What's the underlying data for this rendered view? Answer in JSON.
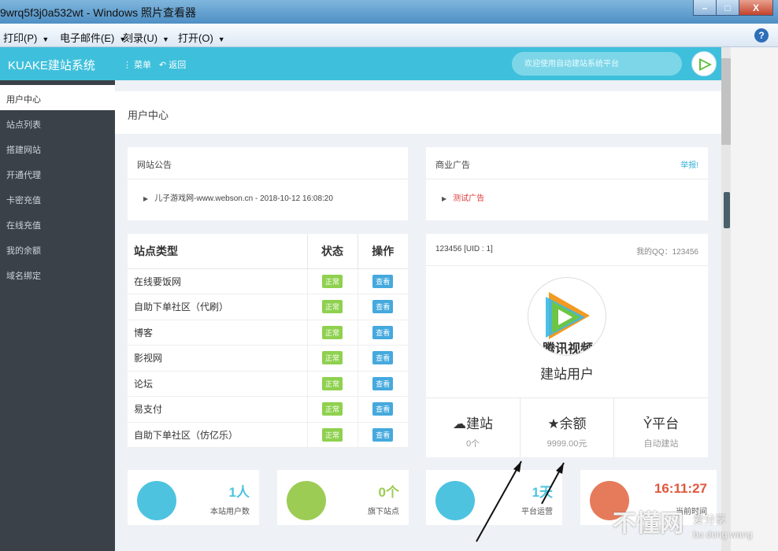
{
  "window": {
    "title": "9wrq5f3j0a532wt - Windows 照片查看器",
    "minimize_label": "–",
    "maximize_label": "□",
    "close_label": "X"
  },
  "menubar": {
    "items": [
      {
        "label": "打印(P)"
      },
      {
        "label": "电子邮件(E)"
      },
      {
        "label": "刻录(U)"
      },
      {
        "label": "打开(O)"
      }
    ],
    "help_label": "?"
  },
  "header": {
    "brand": "KUAKE建站系统",
    "menu_label": "菜单",
    "back_label": "返回",
    "search_placeholder": "欢迎使用自动建站系统平台"
  },
  "sidebar": {
    "items": [
      {
        "label": "用户中心",
        "active": true
      },
      {
        "label": "站点列表"
      },
      {
        "label": "搭建网站"
      },
      {
        "label": "开通代理"
      },
      {
        "label": "卡密充值"
      },
      {
        "label": "在线充值"
      },
      {
        "label": "我的余额"
      },
      {
        "label": "域名绑定"
      }
    ]
  },
  "page": {
    "title": "用户中心"
  },
  "announcement": {
    "title": "网站公告",
    "entry": "儿子游戏网-www.webson.cn - 2018-10-12 16:08:20"
  },
  "ads": {
    "title": "商业广告",
    "action": "举报!",
    "entry": "测试广告"
  },
  "sites_table": {
    "headers": [
      "站点类型",
      "状态",
      "操作"
    ],
    "status_label": "正常",
    "action_label": "查看",
    "rows": [
      "在线要饭网",
      "自助下单社区（代刷）",
      "博客",
      "影视网",
      "论坛",
      "易支付",
      "自助下单社区（仿亿乐）"
    ]
  },
  "profile": {
    "uid": "123456 [UID : 1]",
    "qq": "我的QQ：123456",
    "logo_text": "腾讯视频",
    "name": "建站用户",
    "stats": [
      {
        "label": "建站",
        "value": "0个",
        "icon": "cloud-icon"
      },
      {
        "label": "余额",
        "value": "9999.00元",
        "icon": "star-icon"
      },
      {
        "label": "平台",
        "value": "自动建站",
        "icon": "user-icon"
      }
    ]
  },
  "kpis": [
    {
      "number": "1人",
      "caption": "本站用户数",
      "color": "#4dc3e0",
      "icon": "users-icon",
      "number_color": "#4dc3e0"
    },
    {
      "number": "0个",
      "caption": "旗下站点",
      "color": "#9ccc54",
      "icon": "cloud-icon",
      "number_color": "#9ccc54"
    },
    {
      "number": "1天",
      "caption": "平台运营",
      "color": "#4dc3e0",
      "icon": "calendar-icon",
      "number_color": "#4dc3e0"
    },
    {
      "number": "16:11:27",
      "caption": "当前时间",
      "color": "#e67b5b",
      "icon": "clock-icon",
      "number_color": "#e0573b"
    }
  ],
  "watermark": {
    "main": "不懂网",
    "sub": "爱分享",
    "sub2": "bu dong wang"
  },
  "colors": {
    "accent": "#3ec0dc",
    "sidebar_bg": "#3b4148",
    "ok_badge": "#8fd14f",
    "view_badge": "#45a9de"
  }
}
